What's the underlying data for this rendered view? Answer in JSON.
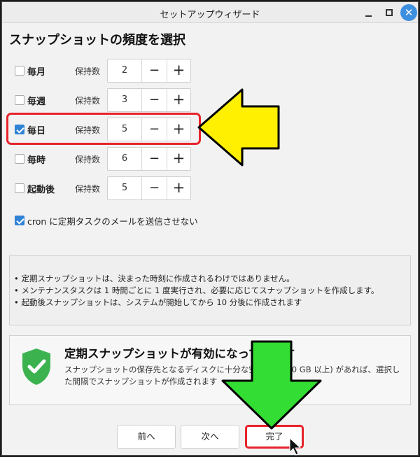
{
  "window": {
    "title": "セットアップウィザード",
    "close_glyph": "✕"
  },
  "heading": "スナップショットの頻度を選択",
  "schedule": {
    "keep_label": "保持数",
    "minus_glyph": "−",
    "plus_glyph": "+",
    "rows": [
      {
        "label": "毎月",
        "checked": false,
        "value": "2"
      },
      {
        "label": "毎週",
        "checked": false,
        "value": "3"
      },
      {
        "label": "毎日",
        "checked": true,
        "value": "5"
      },
      {
        "label": "毎時",
        "checked": false,
        "value": "6"
      },
      {
        "label": "起動後",
        "checked": false,
        "value": "5"
      }
    ]
  },
  "cron": {
    "label": "cron に定期タスクのメールを送信させない",
    "checked": true
  },
  "notes": [
    "• 定期スナップショットは、決まった時刻に作成されるわけではありません。",
    "• メンテナンスタスクは 1 時間ごとに 1 度実行され、必要に応じてスナップショットを作成します。",
    "• 起動後スナップショットは、システムが開始してから 10 分後に作成されます"
  ],
  "status": {
    "title": "定期スナップショットが有効になっています",
    "body": "スナップショットの保存先となるディスクに十分な空き容量 (10 GB 以上) があれば、選択した間隔でスナップショットが作成されます"
  },
  "buttons": {
    "prev": "前へ",
    "next": "次へ",
    "finish": "完了"
  },
  "colors": {
    "accent": "#2f83d6",
    "highlight": "#e8232a",
    "shield": "#3cb24f",
    "yellow_arrow": "#ffef00",
    "green_arrow": "#33dd33"
  }
}
